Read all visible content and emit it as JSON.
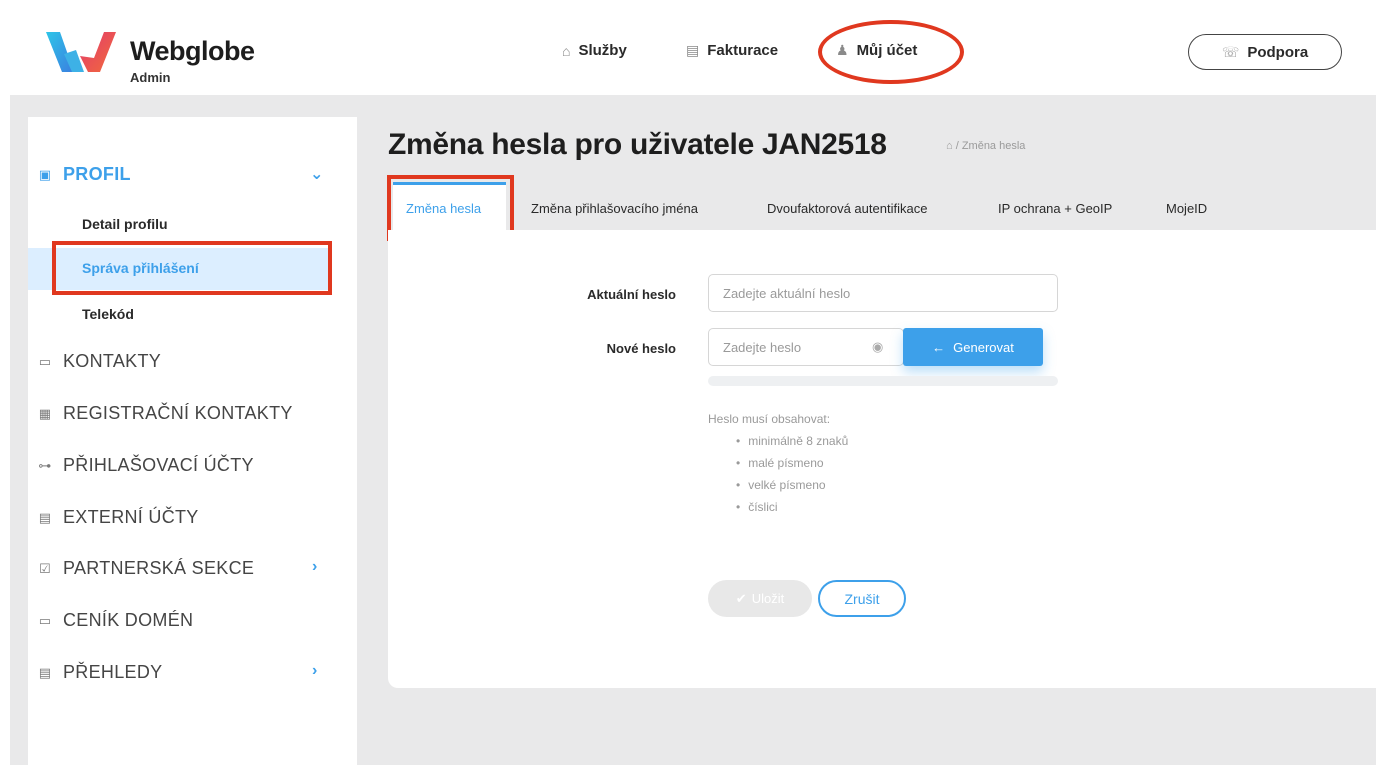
{
  "brand": {
    "name": "Webglobe",
    "sub": "Admin"
  },
  "topnav": [
    {
      "icon": "home-icon",
      "label": "Služby"
    },
    {
      "icon": "invoice-icon",
      "label": "Fakturace"
    },
    {
      "icon": "user-icon",
      "label": "Můj účet"
    }
  ],
  "support": {
    "label": "Podpora",
    "icon": "support-icon"
  },
  "sidebar": {
    "profile": {
      "label": "PROFIL",
      "icon": "id-card-icon"
    },
    "sub_items": [
      "Detail profilu",
      "Správa přihlášení",
      "Telekód"
    ],
    "items": [
      {
        "label": "KONTAKTY",
        "icon": "contacts-icon"
      },
      {
        "label": "REGISTRAČNÍ KONTAKTY",
        "icon": "registration-icon"
      },
      {
        "label": "PŘIHLAŠOVACÍ ÚČTY",
        "icon": "key-icon"
      },
      {
        "label": "EXTERNÍ ÚČTY",
        "icon": "external-icon"
      },
      {
        "label": "PARTNERSKÁ SEKCE",
        "icon": "partner-icon"
      },
      {
        "label": "CENÍK DOMÉN",
        "icon": "price-icon"
      },
      {
        "label": "PŘEHLEDY",
        "icon": "overview-icon"
      }
    ]
  },
  "main": {
    "title": "Změna hesla pro uživatele JAN2518",
    "breadcrumb": "/ Změna hesla",
    "tabs": [
      "Změna hesla",
      "Změna přihlašovacího jména",
      "Dvoufaktorová autentifikace",
      "IP ochrana + GeoIP",
      "MojeID"
    ]
  },
  "form": {
    "current_label": "Aktuální heslo",
    "current_placeholder": "Zadejte aktuální heslo",
    "new_label": "Nové heslo",
    "new_placeholder": "Zadejte heslo",
    "generate": "Generovat",
    "hint_title": "Heslo musí obsahovat:",
    "hints": [
      "minimálně 8 znaků",
      "malé písmeno",
      "velké písmeno",
      "číslici"
    ],
    "save": "Uložit",
    "cancel": "Zrušit"
  },
  "colors": {
    "accent": "#3da0ea",
    "highlight": "#e0381f"
  }
}
